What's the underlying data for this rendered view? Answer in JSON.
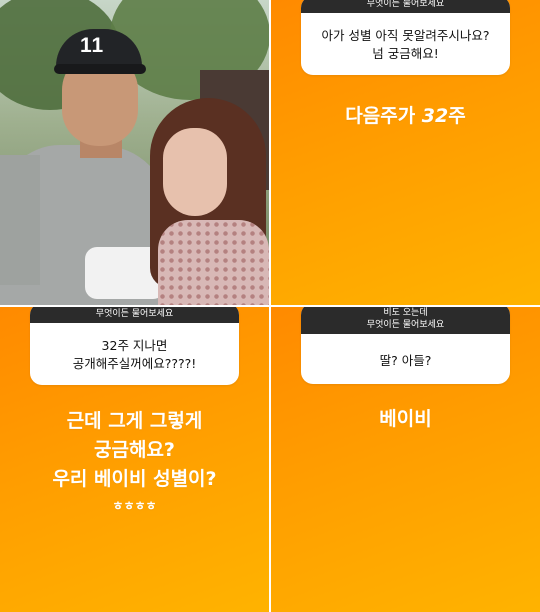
{
  "photo": {
    "cap_text": "11"
  },
  "panel2": {
    "card_header": "무엇이든 물어보세요",
    "question_lines": [
      "아가 성별 아직 못알려주시나요?",
      "넘 궁금해요!"
    ],
    "reply_prefix": "다음주가 ",
    "reply_number": "32",
    "reply_suffix": "주"
  },
  "panel3": {
    "card_header": "무엇이든 물어보세요",
    "question_lines": [
      "32주 지나면",
      "공개해주실꺼에요????!"
    ],
    "reply_lines": [
      "근데 그게 그렇게",
      "궁금해요?",
      "우리 베이비 성별이?",
      "ㅎㅎㅎㅎ"
    ]
  },
  "panel4": {
    "card_header_lines": [
      "비도 오는데",
      "무엇이든 물어보세요"
    ],
    "question_lines": [
      "딸? 아들?"
    ],
    "reply": "베이비"
  },
  "colors": {
    "orange_start": "#ff8a00",
    "orange_end": "#ffb300",
    "card_header_bg": "#2b2b2b"
  }
}
